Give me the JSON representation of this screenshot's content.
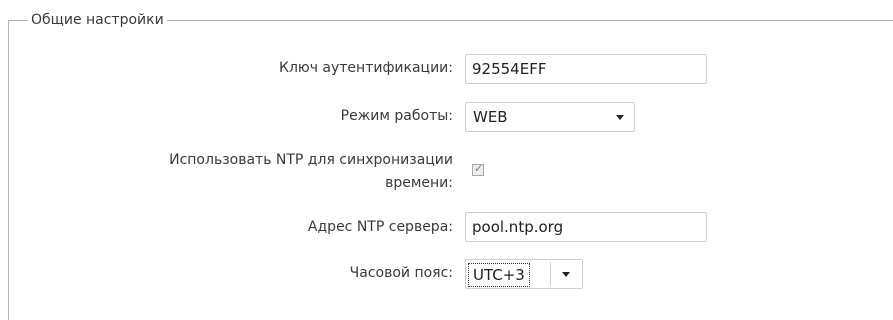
{
  "section": {
    "title": "Общие настройки"
  },
  "fields": {
    "auth_key": {
      "label": "Ключ аутентификации:",
      "value": "92554EFF"
    },
    "mode": {
      "label": "Режим работы:",
      "value": "WEB"
    },
    "use_ntp": {
      "label_line1": "Использовать NTP для синхронизации",
      "label_line2": "времени:",
      "checked": true
    },
    "ntp_server": {
      "label": "Адрес NTP сервера:",
      "value": "pool.ntp.org"
    },
    "timezone": {
      "label": "Часовой пояс:",
      "value": "UTC+3"
    }
  }
}
